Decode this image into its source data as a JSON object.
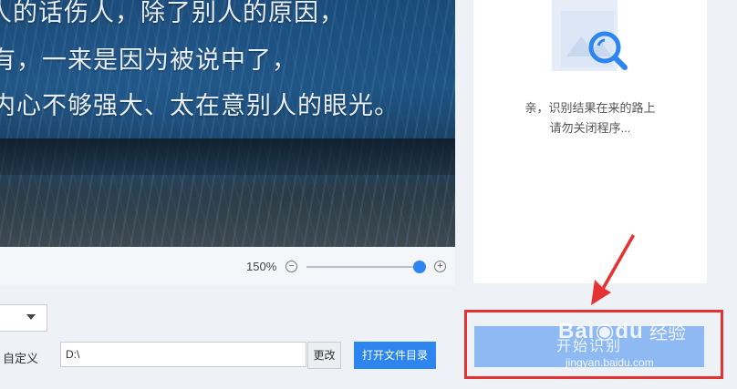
{
  "preview": {
    "lines": [
      "人的话伤人，除了别人的原因，",
      "有，一来是因为被说中了，",
      "内心不够强大、太在意别人的眼光。"
    ]
  },
  "zoom": {
    "label": "150%",
    "minus": "⊖",
    "plus": "⊕",
    "level": 1.0
  },
  "result": {
    "line1": "亲，识别结果在来的路上",
    "line2": "请勿关闭程序..."
  },
  "output": {
    "custom_label": "自定义",
    "path_value": "D:\\",
    "change_label": "更改",
    "open_dir_label": "打开文件目录"
  },
  "start_button": {
    "label": "开始识别"
  },
  "watermark": {
    "brand": "Bai",
    "brand2": "du",
    "jingyan": "经验",
    "url": "jingyan.baidu.com"
  },
  "colors": {
    "accent": "#2d86f0",
    "annotation": "#e53333"
  }
}
